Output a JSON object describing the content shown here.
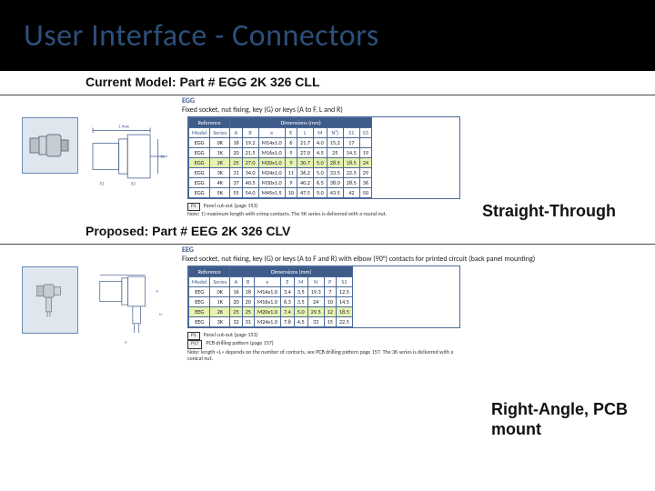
{
  "title": "User Interface - Connectors",
  "current": {
    "label": "Current Model: Part # EGG 2K 326 CLL",
    "type_label": "Straight-Through",
    "spec_title": "EGG",
    "spec_caption": "Fixed socket, nut fixing, key (G) or keys (A to F, L and R)",
    "table": {
      "ref_header": "Reference",
      "dim_header": "Dimensions (mm)",
      "cols": [
        "Model",
        "Series",
        "A",
        "B",
        "e",
        "E",
        "L",
        "M",
        "N¹)",
        "S1",
        "S3"
      ],
      "rows": [
        [
          "EGG",
          "0K",
          "18",
          "19.2",
          "M14x1.0",
          "6",
          "21.7",
          "4.0",
          "15.2",
          "17",
          ""
        ],
        [
          "EGG",
          "1K",
          "20",
          "21.5",
          "M16x1.0",
          "9",
          "27.0",
          "4.5",
          "25",
          "14.5",
          "19"
        ],
        [
          "EGG",
          "2K",
          "25",
          "27.0",
          "M20x1.0",
          "9",
          "30.7",
          "5.0",
          "28.5",
          "18.5",
          "24"
        ],
        [
          "EGG",
          "3K",
          "31",
          "34.0",
          "M24x1.0",
          "11",
          "36.2",
          "5.0",
          "33.5",
          "22.5",
          "29"
        ],
        [
          "EGG",
          "4K",
          "37",
          "40.5",
          "M30x1.0",
          "9",
          "40.2",
          "6.5",
          "38.0",
          "28.5",
          "36"
        ],
        [
          "EGG",
          "5K",
          "55",
          "54.0",
          "M45x1.5",
          "10",
          "47.5",
          "9.0",
          "43.5",
          "42",
          "50"
        ]
      ],
      "hl_index": 2
    },
    "footnote_tag": "P1",
    "footnote_tag_text": "Panel cut-out (page 153)",
    "footnote": "Note: 1) maximum length with crimp contacts. The 5K series is delivered with a round nut."
  },
  "proposed": {
    "label": "Proposed: Part # EEG 2K 326 CLV",
    "type_label": "Right-Angle, PCB mount",
    "spec_title": "EEG",
    "spec_caption": "Fixed socket, nut fixing, key (G) or keys (A to F and R) with elbow (90°) contacts for printed circuit (back panel mounting)",
    "table": {
      "ref_header": "Reference",
      "dim_header": "Dimensions (mm)",
      "cols": [
        "Model",
        "Series",
        "A",
        "B",
        "e",
        "E",
        "M",
        "N",
        "P",
        "S1"
      ],
      "rows": [
        [
          "EEG",
          "0K",
          "16",
          "18",
          "M14x1.0",
          "3.4",
          "3.5",
          "19.3",
          "7",
          "12.5"
        ],
        [
          "EEG",
          "1K",
          "20",
          "20",
          "M16x1.0",
          "6.3",
          "3.5",
          "24",
          "10",
          "14.5"
        ],
        [
          "EEG",
          "2K",
          "25",
          "25",
          "M20x1.0",
          "7.4",
          "5.0",
          "29.5",
          "12",
          "18.5"
        ],
        [
          "EEG",
          "3K",
          "32",
          "31",
          "M24x1.0",
          "7.8",
          "4.5",
          "33",
          "15",
          "22.5"
        ]
      ],
      "hl_index": 2
    },
    "footnote_tag1": "P1",
    "footnote_tag1_text": "Panel cut-out (page 153)",
    "footnote_tag2": "P17",
    "footnote_tag2_text": "PCB drilling pattern (page 157)",
    "footnote": "Note: length «L» depends on the number of contacts, see PCB drilling pattern page 157. The 3K series is delivered with a conical nut."
  }
}
